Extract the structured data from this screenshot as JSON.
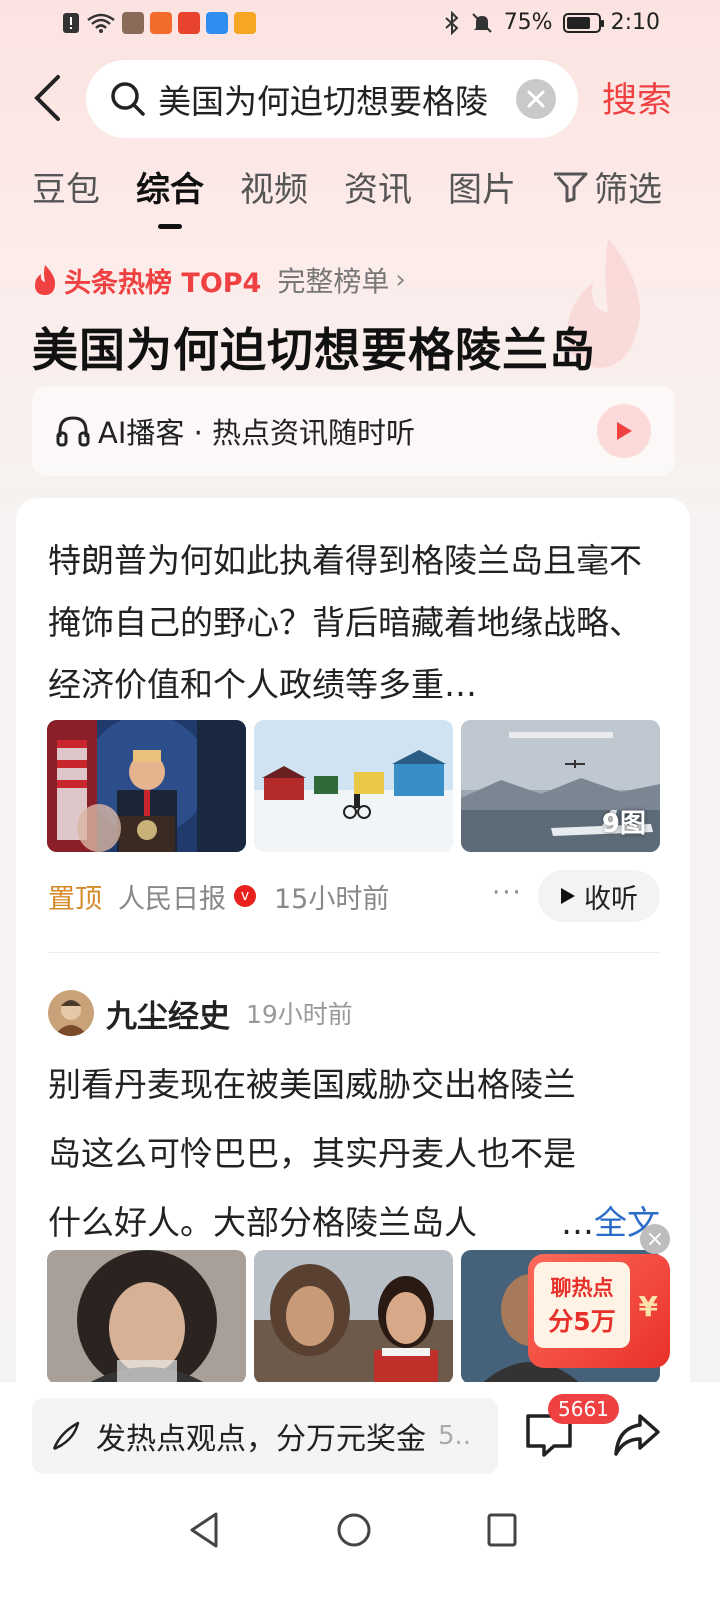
{
  "status_bar": {
    "battery": "75%",
    "battery_level": 0.75,
    "time": "2:10",
    "icons": [
      "sim-alert-icon",
      "wifi-icon",
      "app-notification-icons",
      "bluetooth-icon",
      "mute-icon",
      "battery-icon"
    ]
  },
  "header": {
    "search_query": "美国为何迫切想要格陵",
    "search_button": "搜索"
  },
  "tabs": [
    {
      "label": "豆包"
    },
    {
      "label": "综合",
      "active": true
    },
    {
      "label": "视频"
    },
    {
      "label": "资讯"
    },
    {
      "label": "图片"
    }
  ],
  "filter_label": "筛选",
  "hot": {
    "label": "头条热榜 TOP4",
    "full_list": "完整榜单",
    "headline": "美国为何迫切想要格陵兰岛"
  },
  "ai_podcast": {
    "label": "AI播客 · 热点资讯随时听"
  },
  "article": {
    "text": "特朗普为何如此执着得到格陵兰岛且毫不掩饰自己的野心？背后暗藏着地缘战略、经济价值和个人政绩等多重…",
    "image_count": "9图",
    "pinned": "置顶",
    "source": "人民日报",
    "time": "15小时前",
    "more": "···",
    "listen": "收听"
  },
  "post": {
    "author": "九尘经史",
    "time": "19小时前",
    "line1": "别看丹麦现在被美国威胁交出格陵兰",
    "line2": "岛这么可怜巴巴，其实丹麦人也不是",
    "line3": "什么好人。大部分格陵兰岛人",
    "ellipsis": "…",
    "full_text": "全文"
  },
  "promo": {
    "line1": "聊热点",
    "line2": "分5万",
    "yen": "¥",
    "close": "×"
  },
  "bottom": {
    "comment_placeholder": "发热点观点，分万元奖金",
    "comment_extra": "5..",
    "comment_count": "5661"
  },
  "colors": {
    "accent": "#f04142",
    "link": "#2a6cc8",
    "pinned": "#d68a2a"
  }
}
